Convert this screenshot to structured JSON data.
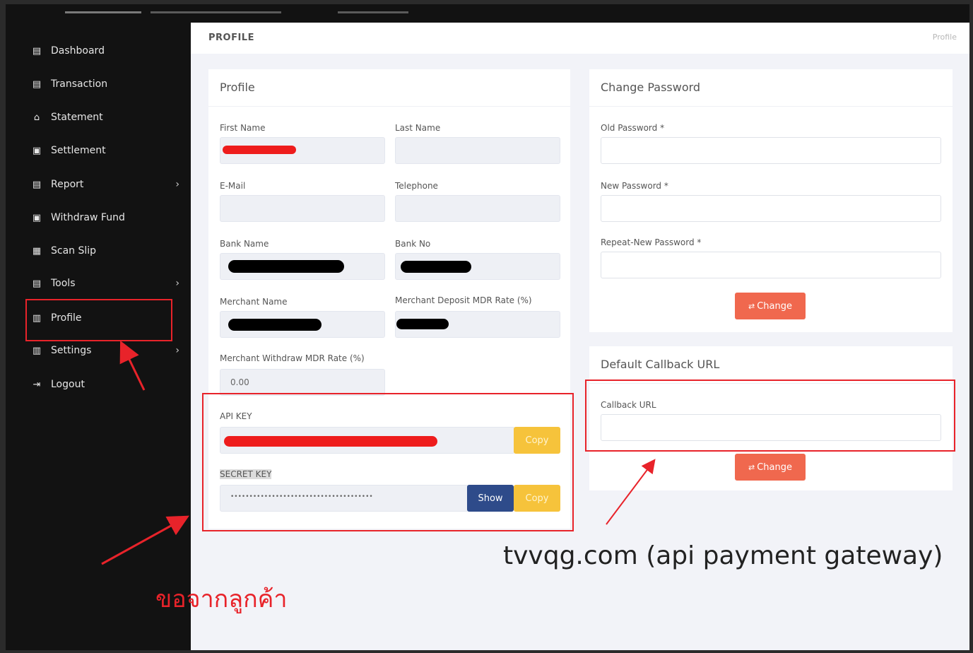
{
  "sidebar": {
    "items": [
      {
        "label": "Dashboard",
        "icon": "grid-icon",
        "chevron": false
      },
      {
        "label": "Transaction",
        "icon": "grid-icon",
        "chevron": false
      },
      {
        "label": "Statement",
        "icon": "bank-icon",
        "chevron": false
      },
      {
        "label": "Settlement",
        "icon": "document-icon",
        "chevron": false
      },
      {
        "label": "Report",
        "icon": "grid-icon",
        "chevron": true
      },
      {
        "label": "Withdraw Fund",
        "icon": "document-icon",
        "chevron": false
      },
      {
        "label": "Scan Slip",
        "icon": "grid-icon",
        "chevron": false
      },
      {
        "label": "Tools",
        "icon": "grid-icon",
        "chevron": true
      },
      {
        "label": "Profile",
        "icon": "id-card-icon",
        "chevron": false
      },
      {
        "label": "Settings",
        "icon": "id-card-icon",
        "chevron": true
      },
      {
        "label": "Logout",
        "icon": "logout-icon",
        "chevron": false
      }
    ]
  },
  "header": {
    "title": "PROFILE",
    "breadcrumb": "Profile"
  },
  "profile_card": {
    "title": "Profile",
    "first_name_label": "First Name",
    "last_name_label": "Last Name",
    "email_label": "E-Mail",
    "telephone_label": "Telephone",
    "bank_name_label": "Bank Name",
    "bank_no_label": "Bank No",
    "merchant_name_label": "Merchant Name",
    "deposit_mdr_label": "Merchant Deposit MDR Rate (%)",
    "withdraw_mdr_label": "Merchant Withdraw MDR Rate (%)",
    "withdraw_mdr_value": "0.00",
    "api_key_label": "API KEY",
    "copy_label": "Copy",
    "secret_key_label": "SECRET KEY",
    "secret_key_value": "••••••••••••••••••••••••••••••••••••••",
    "show_label": "Show"
  },
  "password_card": {
    "title": "Change Password",
    "old_label": "Old Password *",
    "new_label": "New Password *",
    "repeat_label": "Repeat-New Password *",
    "change_label": "Change"
  },
  "callback_card": {
    "title": "Default Callback URL",
    "url_label": "Callback URL",
    "change_label": "Change"
  },
  "annotations": {
    "caption": "tvvqg.com (api payment gateway)",
    "thai_note": "ขอจากลูกค้า"
  },
  "colors": {
    "accent_orange": "#f0684e",
    "copy_yellow": "#f6c33b",
    "show_navy": "#2e4b8a",
    "annotation_red": "#e8232a"
  }
}
